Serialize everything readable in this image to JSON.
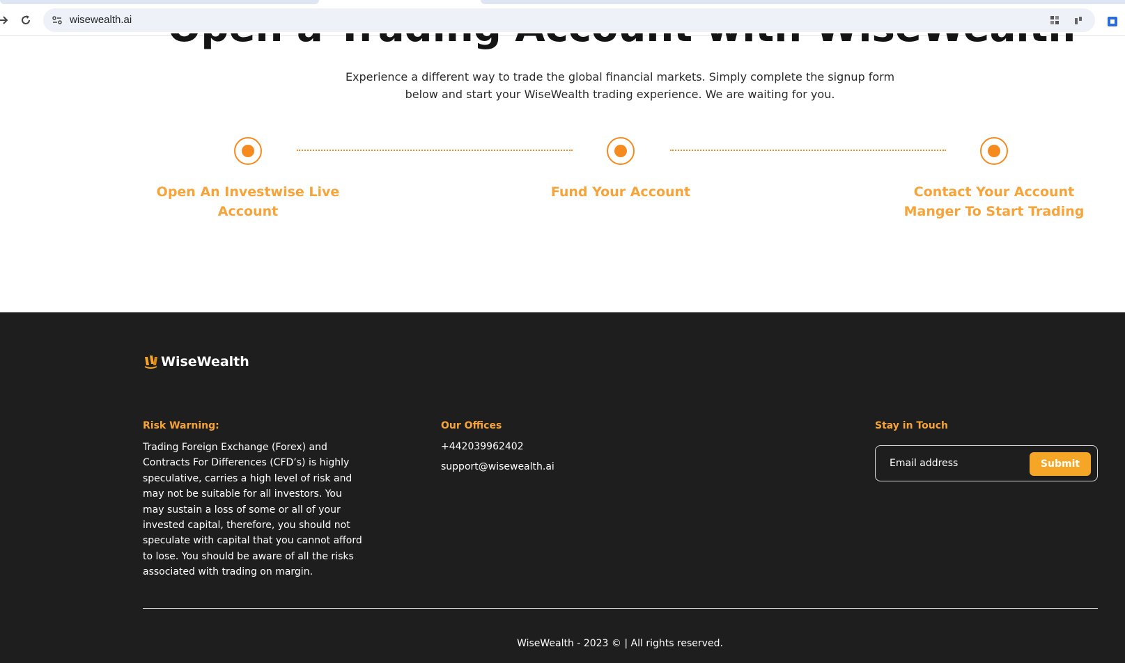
{
  "browser": {
    "url": "wisewealth.ai"
  },
  "hero": {
    "title": "Open a Trading Account with WiseWealth",
    "subtitle": "Experience a different way to trade the global financial markets. Simply complete the signup form below and start your WiseWealth trading experience. We are waiting for you."
  },
  "steps": [
    {
      "label": "Open An Investwise Live Account"
    },
    {
      "label": "Fund Your Account"
    },
    {
      "label": "Contact Your Account Manger To Start Trading"
    }
  ],
  "colors": {
    "accent": "#f58a1f",
    "accent_text": "#f6a43a",
    "footer_bg": "#1e1e1e",
    "button": "#f6a626"
  },
  "footer": {
    "brand": "WiseWealth",
    "risk": {
      "heading": "Risk Warning:",
      "text": "Trading Foreign Exchange (Forex) and Contracts For Differences (CFD’s) is highly speculative, carries a high level of risk and may not be suitable for all investors. You may sustain a loss of some or all of your invested capital, therefore, you should not speculate with capital that you cannot afford to lose. You should be aware of all the risks associated with trading on margin."
    },
    "offices": {
      "heading": "Our Offices",
      "phone": "+442039962402",
      "email": "support@wisewealth.ai"
    },
    "newsletter": {
      "heading": "Stay in Touch",
      "placeholder": "Email address",
      "submit_label": "Submit"
    },
    "copyright": "WiseWealth - 2023 © | All rights reserved."
  }
}
